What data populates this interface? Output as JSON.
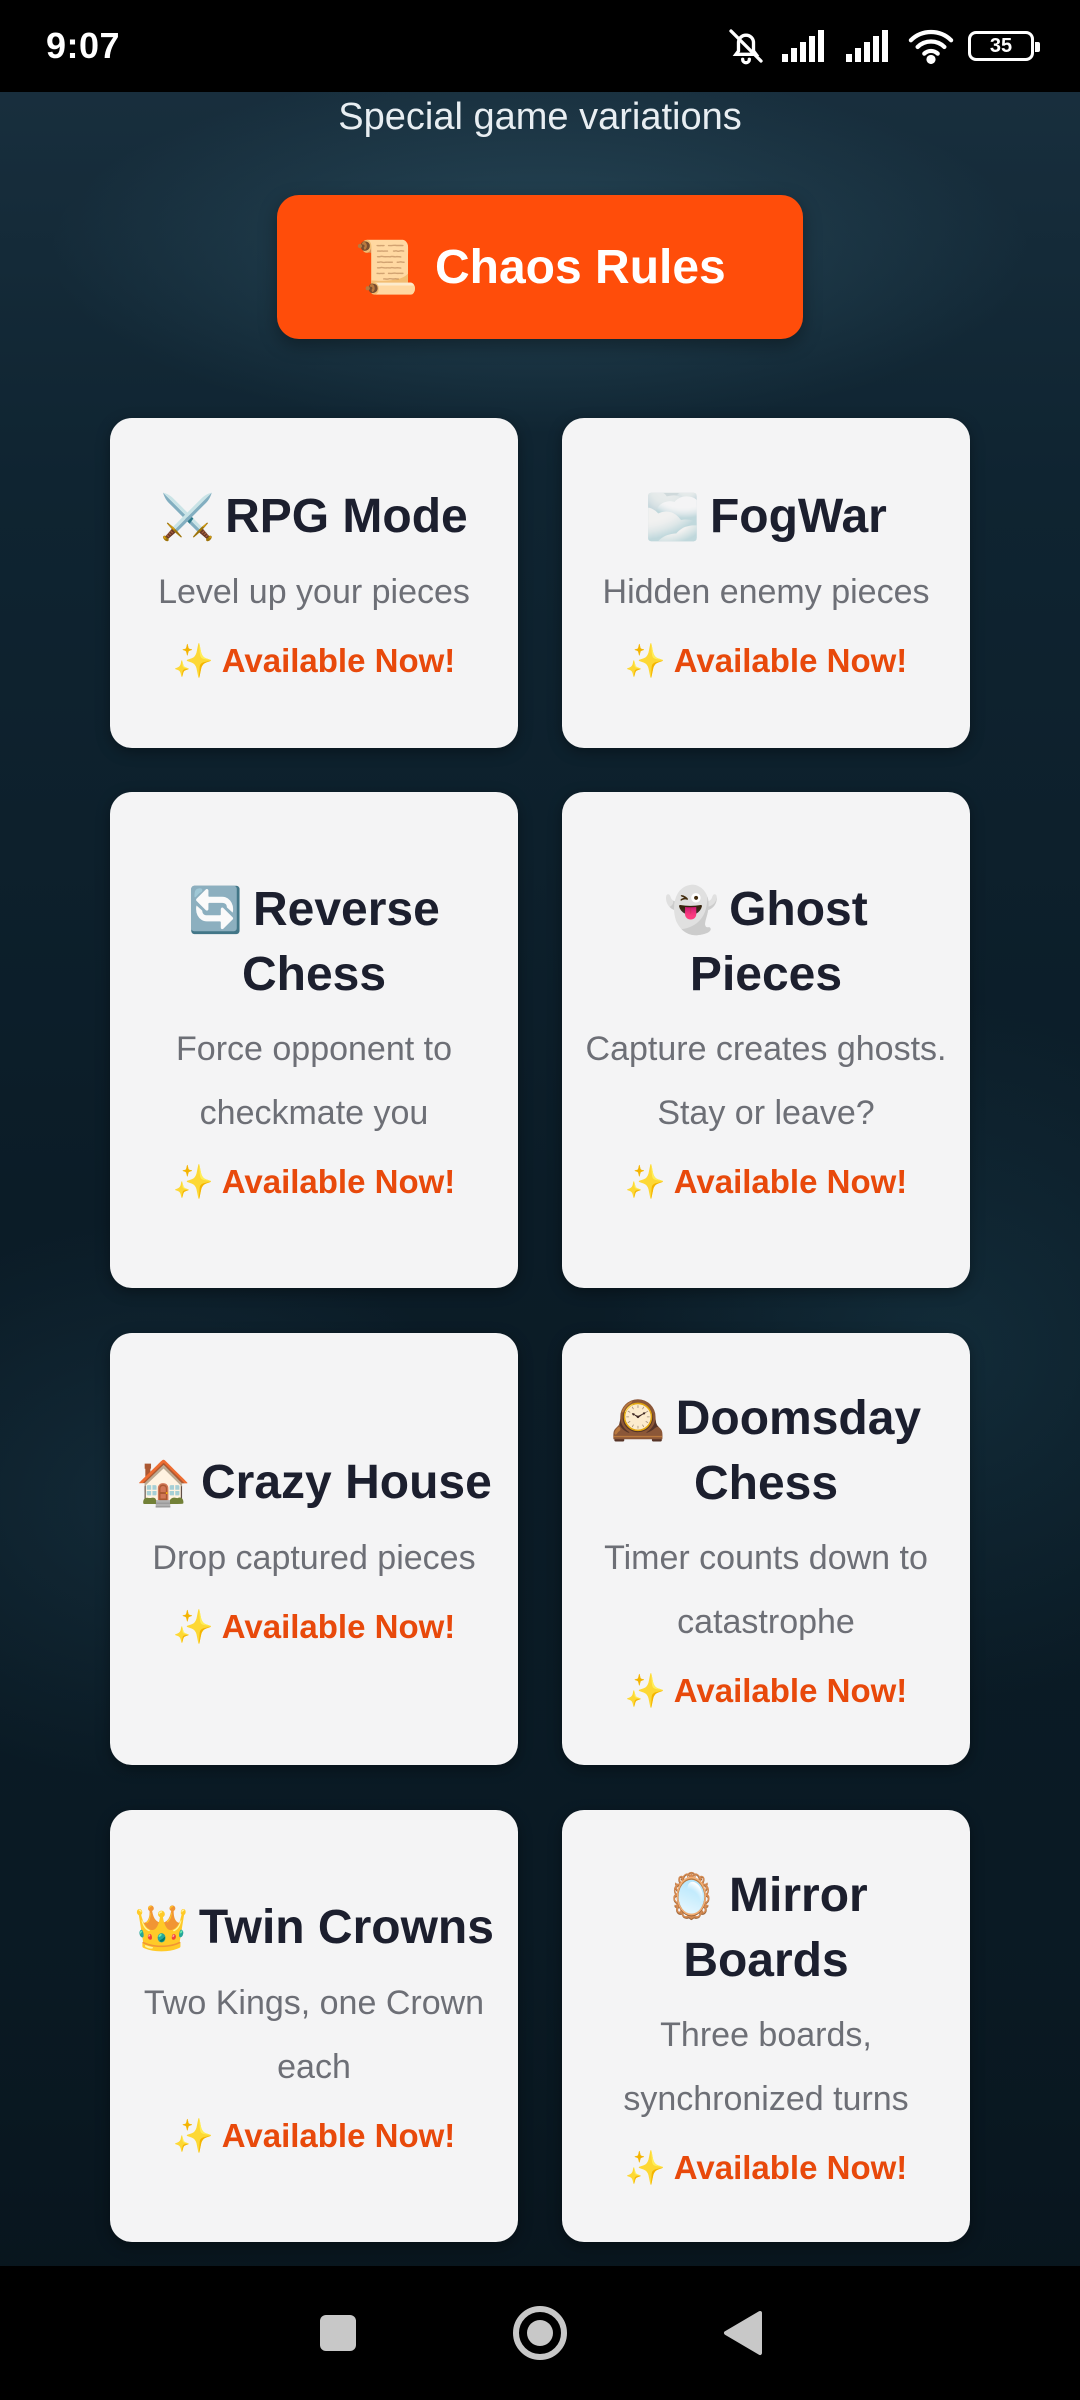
{
  "status_bar": {
    "time": "9:07",
    "battery_level": "35",
    "icons": [
      "bell-off-icon",
      "signal-icon",
      "signal-icon",
      "wifi-icon",
      "battery-icon"
    ]
  },
  "header": {
    "subtitle": "Special game variations"
  },
  "chaos_button": {
    "icon": "📜",
    "label": "Chaos Rules",
    "color": "#ff4d0a"
  },
  "status_label": "Available Now!",
  "status_icon": "✨",
  "modes": [
    {
      "emoji": "⚔️",
      "title": "RPG Mode",
      "description": "Level up your pieces",
      "status": "✨ Available Now!"
    },
    {
      "emoji": "🌫️",
      "title": "FogWar",
      "description": "Hidden enemy pieces",
      "status": "✨ Available Now!"
    },
    {
      "emoji": "🔄",
      "title": "Reverse Chess",
      "description": "Force opponent to checkmate you",
      "status": "✨ Available Now!"
    },
    {
      "emoji": "👻",
      "title": "Ghost Pieces",
      "description": "Capture creates ghosts. Stay or leave?",
      "status": "✨ Available Now!"
    },
    {
      "emoji": "🏠",
      "title": "Crazy House",
      "description": "Drop captured pieces",
      "status": "✨ Available Now!"
    },
    {
      "emoji": "🕰️",
      "title": "Doomsday Chess",
      "description": "Timer counts down to catastrophe",
      "status": "✨ Available Now!"
    },
    {
      "emoji": "👑",
      "title": "Twin Crowns",
      "description": "Two Kings, one Crown each",
      "status": "✨ Available Now!"
    },
    {
      "emoji": "🪞",
      "title": "Mirror Boards",
      "description": "Three boards, synchronized turns",
      "status": "✨ Available Now!"
    }
  ],
  "nav_bar": {
    "buttons": [
      "recents-button",
      "home-button",
      "back-button"
    ]
  },
  "colors": {
    "accent": "#ff4d0a",
    "status_text": "#e8490b",
    "card_bg": "#f4f4f5",
    "title_text": "#1c1f2e"
  }
}
